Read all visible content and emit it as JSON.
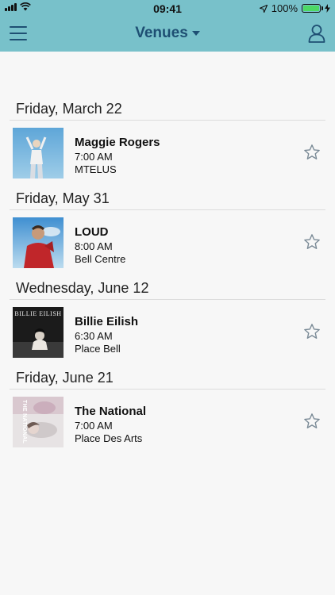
{
  "status": {
    "time": "09:41",
    "battery_text": "100%"
  },
  "nav": {
    "title": "Venues",
    "menu_icon": "hamburger-menu-icon",
    "profile_icon": "user-profile-icon"
  },
  "sections": [
    {
      "date": "Friday, March 22",
      "event": {
        "title": "Maggie Rogers",
        "time": "7:00 AM",
        "venue": "MTELUS"
      }
    },
    {
      "date": "Friday, May 31",
      "event": {
        "title": "LOUD",
        "time": "8:00 AM",
        "venue": "Bell Centre"
      }
    },
    {
      "date": "Wednesday, June 12",
      "event": {
        "title": "Billie Eilish",
        "time": "6:30 AM",
        "venue": "Place Bell",
        "thumb_text": "BILLIE EILISH"
      }
    },
    {
      "date": "Friday, June 21",
      "event": {
        "title": "The National",
        "time": "7:00 AM",
        "venue": "Place Des Arts",
        "thumb_text": "THE NATIONAL"
      }
    }
  ],
  "colors": {
    "header_bg": "#78c1ca",
    "nav_text": "#1e4f73",
    "star_outline": "#7a8a96"
  }
}
